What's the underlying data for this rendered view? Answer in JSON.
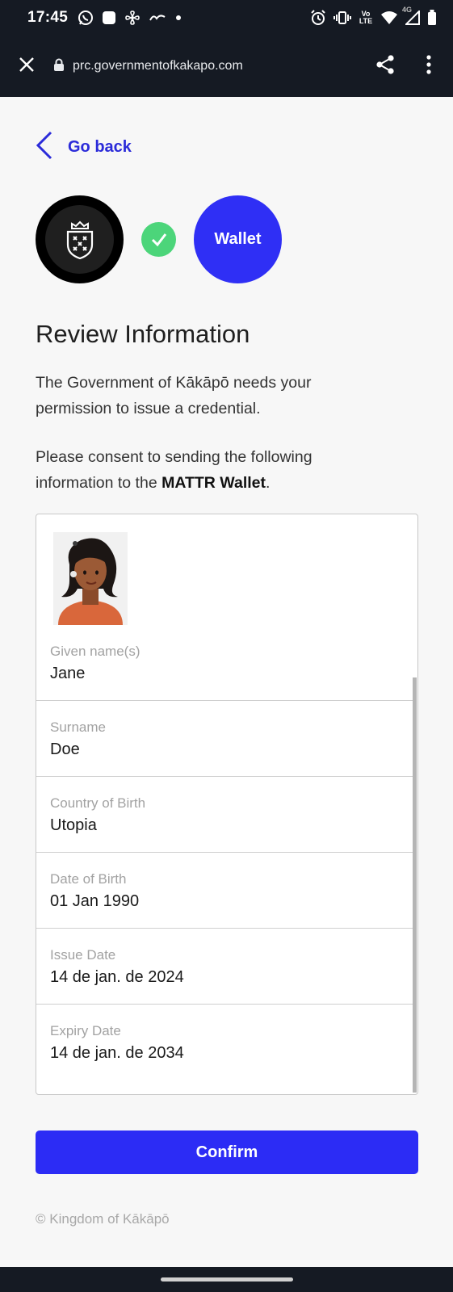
{
  "status_bar": {
    "time": "17:45",
    "network_label": "Vo LTE",
    "network_type": "4G",
    "icons": [
      "whatsapp-icon",
      "square-notification-icon",
      "fan-icon",
      "app-notification-icon",
      "dot-icon",
      "alarm-icon",
      "vibrate-icon",
      "volte-icon",
      "wifi-icon",
      "signal-icon",
      "battery-icon"
    ]
  },
  "browser": {
    "url": "prc.governmentofkakapo.com",
    "icons": [
      "close-icon",
      "lock-icon",
      "share-icon",
      "more-vert-icon"
    ]
  },
  "page": {
    "go_back": "Go back",
    "wallet_label": "Wallet",
    "heading": "Review Information",
    "intro": "The Government of Kākāpō needs your permission to issue a credential.",
    "consent_prefix": "Please consent to sending the following information to the ",
    "consent_wallet": "MATTR Wallet",
    "consent_suffix": ".",
    "confirm": "Confirm",
    "footer": "© Kingdom of Kākāpō"
  },
  "credential": {
    "fields": [
      {
        "label": "Given name(s)",
        "value": "Jane"
      },
      {
        "label": "Surname",
        "value": "Doe"
      },
      {
        "label": "Country of Birth",
        "value": "Utopia"
      },
      {
        "label": "Date of Birth",
        "value": "01 Jan 1990"
      },
      {
        "label": "Issue Date",
        "value": "14 de jan. de 2024"
      },
      {
        "label": "Expiry Date",
        "value": "14 de jan. de 2034"
      }
    ]
  },
  "colors": {
    "accent": "#2c2cf5",
    "link": "#2b2bd9",
    "success": "#4cd57a",
    "chrome": "#151a23"
  }
}
